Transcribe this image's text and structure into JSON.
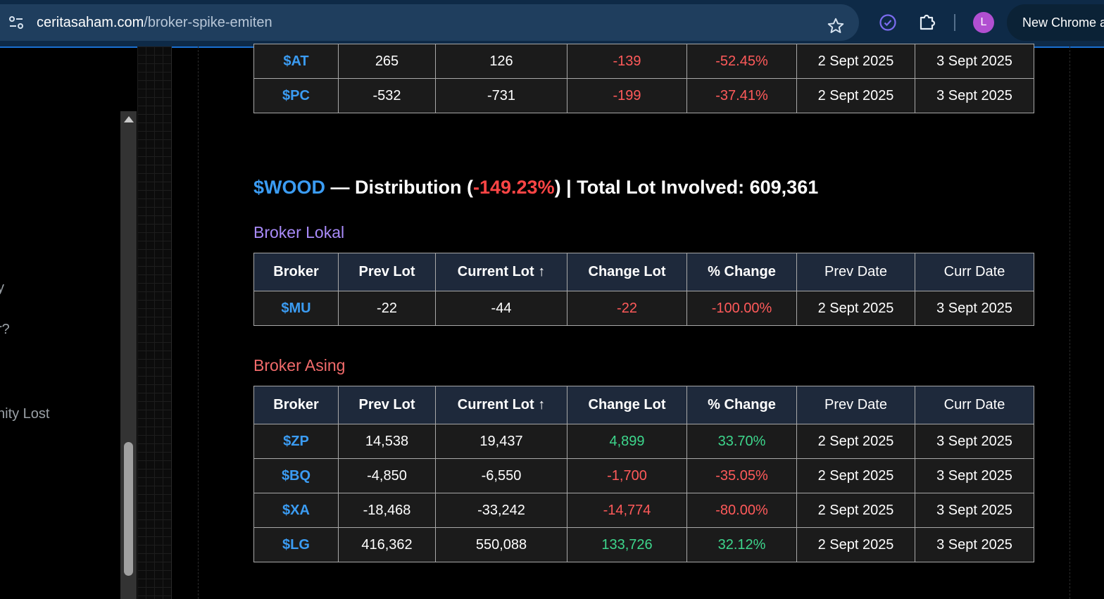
{
  "browser": {
    "url_domain": "ceritasaham.com",
    "url_path": "/broker-spike-emiten",
    "profile_initial": "L",
    "new_chrome_label": "New Chrome a"
  },
  "sidebar": {
    "fragments": [
      "y",
      "r?",
      "nity Lost"
    ]
  },
  "previous_table": {
    "rows": [
      {
        "broker": "$AT",
        "prev_lot": "265",
        "current_lot": "126",
        "change_lot": "-139",
        "pct_change": "-52.45%",
        "prev_date": "2 Sept 2025",
        "curr_date": "3 Sept 2025"
      },
      {
        "broker": "$PC",
        "prev_lot": "-532",
        "current_lot": "-731",
        "change_lot": "-199",
        "pct_change": "-37.41%",
        "prev_date": "2 Sept 2025",
        "curr_date": "3 Sept 2025"
      }
    ]
  },
  "section": {
    "ticker": "$WOOD",
    "dash_type": " — Distribution (",
    "pct": "-149.23%",
    "total_text": ") | Total Lot Involved: 609,361"
  },
  "columns": {
    "broker": "Broker",
    "prev_lot": "Prev Lot",
    "current_lot": "Current Lot ↑",
    "change_lot": "Change Lot",
    "pct_change": "% Change",
    "prev_date": "Prev Date",
    "curr_date": "Curr Date"
  },
  "broker_lokal": {
    "title": "Broker Lokal",
    "rows": [
      {
        "broker": "$MU",
        "prev_lot": "-22",
        "current_lot": "-44",
        "change_lot": "-22",
        "pct_change": "-100.00%",
        "prev_date": "2 Sept 2025",
        "curr_date": "3 Sept 2025"
      }
    ]
  },
  "broker_asing": {
    "title": "Broker Asing",
    "rows": [
      {
        "broker": "$ZP",
        "prev_lot": "14,538",
        "current_lot": "19,437",
        "change_lot": "4,899",
        "pct_change": "33.70%",
        "prev_date": "2 Sept 2025",
        "curr_date": "3 Sept 2025"
      },
      {
        "broker": "$BQ",
        "prev_lot": "-4,850",
        "current_lot": "-6,550",
        "change_lot": "-1,700",
        "pct_change": "-35.05%",
        "prev_date": "2 Sept 2025",
        "curr_date": "3 Sept 2025"
      },
      {
        "broker": "$XA",
        "prev_lot": "-18,468",
        "current_lot": "-33,242",
        "change_lot": "-14,774",
        "pct_change": "-80.00%",
        "prev_date": "2 Sept 2025",
        "curr_date": "3 Sept 2025"
      },
      {
        "broker": "$LG",
        "prev_lot": "416,362",
        "current_lot": "550,088",
        "change_lot": "133,726",
        "pct_change": "32.12%",
        "prev_date": "2 Sept 2025",
        "curr_date": "3 Sept 2025"
      }
    ]
  },
  "colors": {
    "ticker": "#3b9cf3",
    "negative": "#ff5a5a",
    "positive": "#3dd68c",
    "header_bg": "#1e293b",
    "lokal_heading": "#a98bfa",
    "asing_heading": "#f26b6b"
  },
  "icons": [
    "site-info-icon",
    "bookmark-star-icon",
    "extension-clock-icon",
    "extensions-puzzle-icon"
  ]
}
